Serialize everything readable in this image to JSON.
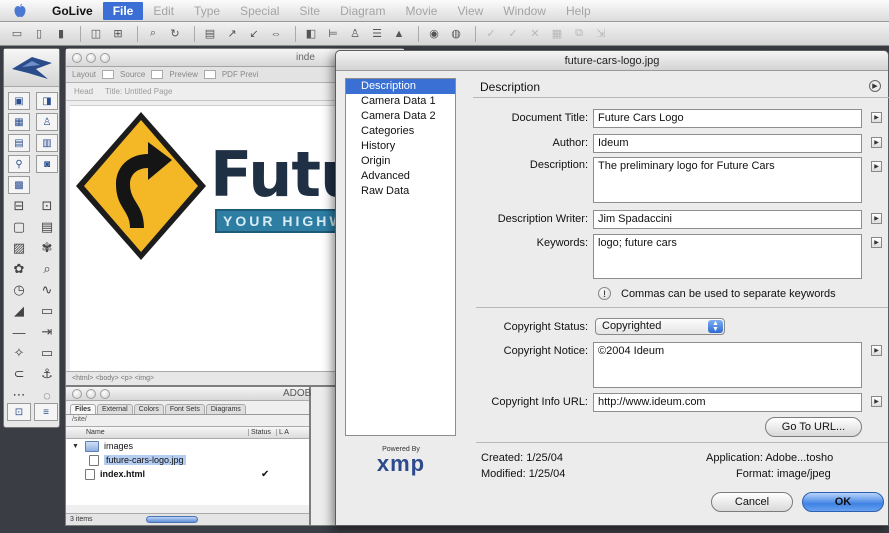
{
  "menubar": {
    "app": "GoLive",
    "items": [
      "File",
      "Edit",
      "Type",
      "Special",
      "Site",
      "Diagram",
      "Movie",
      "View",
      "Window",
      "Help"
    ],
    "active": "File"
  },
  "doc_window": {
    "title": "inde",
    "tabs": [
      "Layout",
      "Source",
      "Preview",
      "PDF Previ"
    ],
    "head_label": "Head",
    "page_title_label": "Title: Untitled Page",
    "logo_text": "Futur",
    "banner_text": "YOUR HIGHWA",
    "status_path": "<html> <body> <p> <img>"
  },
  "site_window": {
    "tabs": [
      "Files",
      "External",
      "Colors",
      "Font Sets",
      "Diagrams"
    ],
    "path": "/site/",
    "columns": {
      "name": "Name",
      "status": "Status",
      "extra": "L A"
    },
    "rows": [
      {
        "name": "images",
        "type": "folder",
        "expanded": true,
        "selected": false,
        "check": ""
      },
      {
        "name": "future-cars-logo.jpg",
        "type": "image",
        "expanded": false,
        "selected": true,
        "check": ""
      },
      {
        "name": "index.html",
        "type": "html",
        "expanded": false,
        "selected": false,
        "check": "✔"
      }
    ],
    "footer": "3 items",
    "footer_right": "0 ite"
  },
  "adobe_panel": {
    "label": "ADOB"
  },
  "dialog": {
    "title": "future-cars-logo.jpg",
    "categories": [
      "Description",
      "Camera Data 1",
      "Camera Data 2",
      "Categories",
      "History",
      "Origin",
      "Advanced",
      "Raw Data"
    ],
    "selected_category": "Description",
    "panel_title": "Description",
    "fields": {
      "document_title_label": "Document Title:",
      "document_title": "Future Cars Logo",
      "author_label": "Author:",
      "author": "Ideum",
      "description_label": "Description:",
      "description": "The preliminary logo for Future Cars",
      "description_writer_label": "Description Writer:",
      "description_writer": "Jim Spadaccini",
      "keywords_label": "Keywords:",
      "keywords": "logo; future cars",
      "keywords_hint": "Commas can be used to separate keywords",
      "copyright_status_label": "Copyright Status:",
      "copyright_status": "Copyrighted",
      "copyright_notice_label": "Copyright Notice:",
      "copyright_notice": "©2004 Ideum",
      "copyright_url_label": "Copyright Info URL:",
      "copyright_url": "http://www.ideum.com"
    },
    "goto_url_label": "Go To URL...",
    "xmp_powered": "Powered By",
    "xmp_logo": "xmp",
    "meta": {
      "created": "Created:  1/25/04",
      "modified": "Modified:  1/25/04",
      "application": "Application:  Adobe...tosho",
      "format": "Format:  image/jpeg"
    },
    "cancel_label": "Cancel",
    "ok_label": "OK"
  },
  "colors": {
    "selection": "#3a6fd4",
    "accent_button": "#3f82e4",
    "logo_sign": "#f4b827"
  }
}
